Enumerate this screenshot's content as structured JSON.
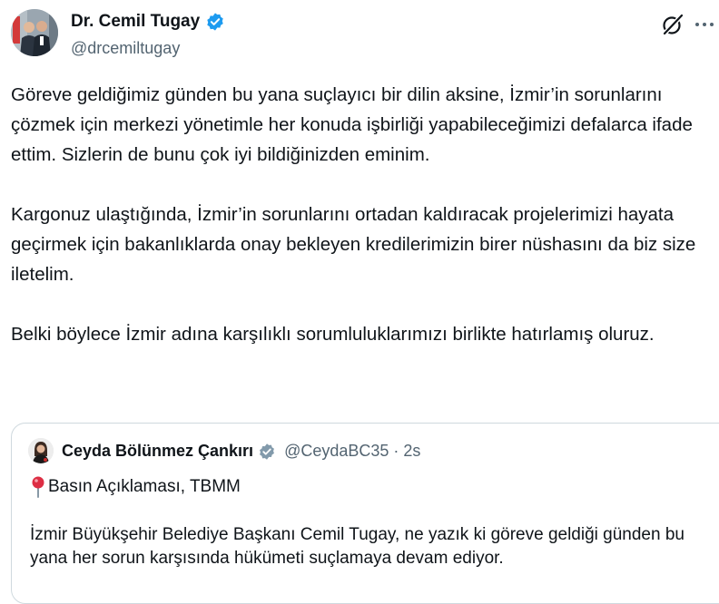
{
  "tweet": {
    "author": {
      "display_name": "Dr. Cemil Tugay",
      "handle": "@drcemiltugay",
      "verified": true
    },
    "paragraphs": [
      "Göreve geldiğimiz günden bu yana suçlayıcı bir dilin aksine, İzmir’in sorunlarını çözmek için merkezi yönetimle her konuda işbirliği yapabileceğimizi defalarca ifade ettim. Sizlerin de bunu çok iyi bildiğinizden eminim.",
      "Kargonuz ulaştığında, İzmir’in sorunlarını ortadan kaldıracak projelerimizi hayata geçirmek için bakanlıklarda onay bekleyen kredilerimizin birer nüshasını da biz size iletelim.",
      "Belki böylece İzmir adına karşılıklı sorumluluklarımızı birlikte hatırlamış oluruz."
    ]
  },
  "quoted_tweet": {
    "author": {
      "display_name": "Ceyda Bölünmez Çankırı",
      "handle": "@CeydaBC35",
      "separator": "·",
      "time": "2s",
      "verified": true
    },
    "line1": "Basın Açıklaması, TBMM",
    "text": "İzmir Büyükşehir Belediye Başkanı Cemil Tugay, ne yazık ki göreve geldiği günden bu yana her sorun karşısında hükümeti suçlamaya devam ediyor."
  },
  "icons": {
    "verified": "verified-badge-icon",
    "grok": "grok-icon",
    "more": "more-icon",
    "pin": "pin-icon"
  },
  "colors": {
    "verified_blue": "#1d9bf0",
    "text_primary": "#0f1419",
    "text_secondary": "#536471",
    "border": "#cfd9de",
    "pin_red": "#dd2e44"
  }
}
